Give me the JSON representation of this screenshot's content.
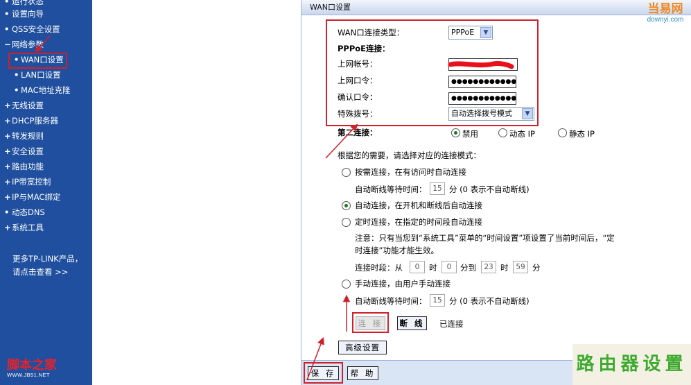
{
  "sidebar": {
    "items": [
      {
        "bullet": "•",
        "label": "运行状态"
      },
      {
        "bullet": "•",
        "label": "设置向导"
      },
      {
        "bullet": "•",
        "label": "QSS安全设置"
      },
      {
        "bullet": "−",
        "label": "网络参数"
      },
      {
        "bullet": "•",
        "label": "WAN口设置"
      },
      {
        "bullet": "•",
        "label": "LAN口设置"
      },
      {
        "bullet": "•",
        "label": "MAC地址克隆"
      },
      {
        "bullet": "+",
        "label": "无线设置"
      },
      {
        "bullet": "+",
        "label": "DHCP服务器"
      },
      {
        "bullet": "+",
        "label": "转发规则"
      },
      {
        "bullet": "+",
        "label": "安全设置"
      },
      {
        "bullet": "+",
        "label": "路由功能"
      },
      {
        "bullet": "+",
        "label": "IP带宽控制"
      },
      {
        "bullet": "+",
        "label": "IP与MAC绑定"
      },
      {
        "bullet": "•",
        "label": "动态DNS"
      },
      {
        "bullet": "+",
        "label": "系统工具"
      }
    ],
    "promo_line1": "更多TP-LINK产品，",
    "promo_line2": "请点击查看 >>",
    "logo_text": "脚本之家",
    "logo_url": "WWW.JB51.NET"
  },
  "panel": {
    "title": "WAN口设置",
    "wan_type_label": "WAN口连接类型：",
    "wan_type_value": "PPPoE",
    "pppoe_heading": "PPPoE连接：",
    "account_label": "上网帐号：",
    "account_value": "",
    "password_label": "上网口令：",
    "password_value": "●●●●●●●●●●●●●",
    "confirm_label": "确认口令：",
    "confirm_value": "●●●●●●●●●●●●●",
    "dial_label": "特殊拨号：",
    "dial_value": "自动选择拨号模式",
    "second_conn_label": "第二连接：",
    "second_opt1": "禁用",
    "second_opt2": "动态 IP",
    "second_opt3": "静态 IP",
    "mode_prompt": "根据您的需要，请选择对应的连接模式：",
    "mode1": "按需连接，在有访问时自动连接",
    "idle_label": "自动断线等待时间：",
    "idle_value": "15",
    "idle_unit": "分  (0 表示不自动断线)",
    "mode2": "自动连接，在开机和断线后自动连接",
    "mode3": "定时连接，在指定的时间段自动连接",
    "note_line1": "注意：只有当您到“系统工具”菜单的“时间设置”项设置了当前时间后，“定",
    "note_line2": "时连接”功能才能生效。",
    "period_label": "连接时段：从",
    "period_from_h": "0",
    "hour_unit": "时",
    "period_from_m": "0",
    "to_label": "分到",
    "period_to_h": "23",
    "period_to_m": "59",
    "min_unit": "分",
    "mode4": "手动连接，由用户手动连接",
    "manual_idle_value": "15",
    "connect_btn": "连 接",
    "disconnect_btn": "断 线",
    "status": "已连接",
    "advanced_btn": "高级设置",
    "save_btn": "保 存",
    "help_btn": "帮 助"
  },
  "watermark": {
    "brand_main": "当易网",
    "brand_sub": "downyi.com",
    "footer_text": "路由器设置"
  },
  "colors": {
    "sidebar_bg": "#1f4f9e",
    "highlight_red": "#d0202c",
    "radio_selected": "#1b7a1b",
    "watermark_green": "#3ea92f"
  }
}
